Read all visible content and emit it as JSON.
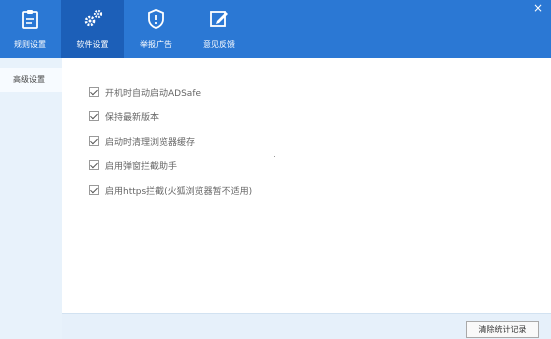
{
  "tabs": [
    {
      "label": "规则设置",
      "icon": "clipboard-icon"
    },
    {
      "label": "软件设置",
      "icon": "gears-icon"
    },
    {
      "label": "举报广告",
      "icon": "shield-icon"
    },
    {
      "label": "意见反馈",
      "icon": "edit-icon"
    }
  ],
  "active_tab": 1,
  "close_label": "×",
  "sidebar": {
    "items": [
      {
        "label": "高级设置"
      }
    ]
  },
  "options": [
    {
      "label": "开机时自动启动ADSafe",
      "checked": true
    },
    {
      "label": "保持最新版本",
      "checked": true
    },
    {
      "label": "启动时清理浏览器缓存",
      "checked": true
    },
    {
      "label": "启用弹窗拦截助手",
      "checked": true
    },
    {
      "label": "启用https拦截(火狐浏览器暂不适用)",
      "checked": true
    }
  ],
  "footer": {
    "clear_button_label": "清除统计记录"
  },
  "colors": {
    "header": "#2b78d4",
    "active_tab": "#1c5fb8",
    "sidebar": "#e8f2fb",
    "footer": "#e6f0fa"
  }
}
